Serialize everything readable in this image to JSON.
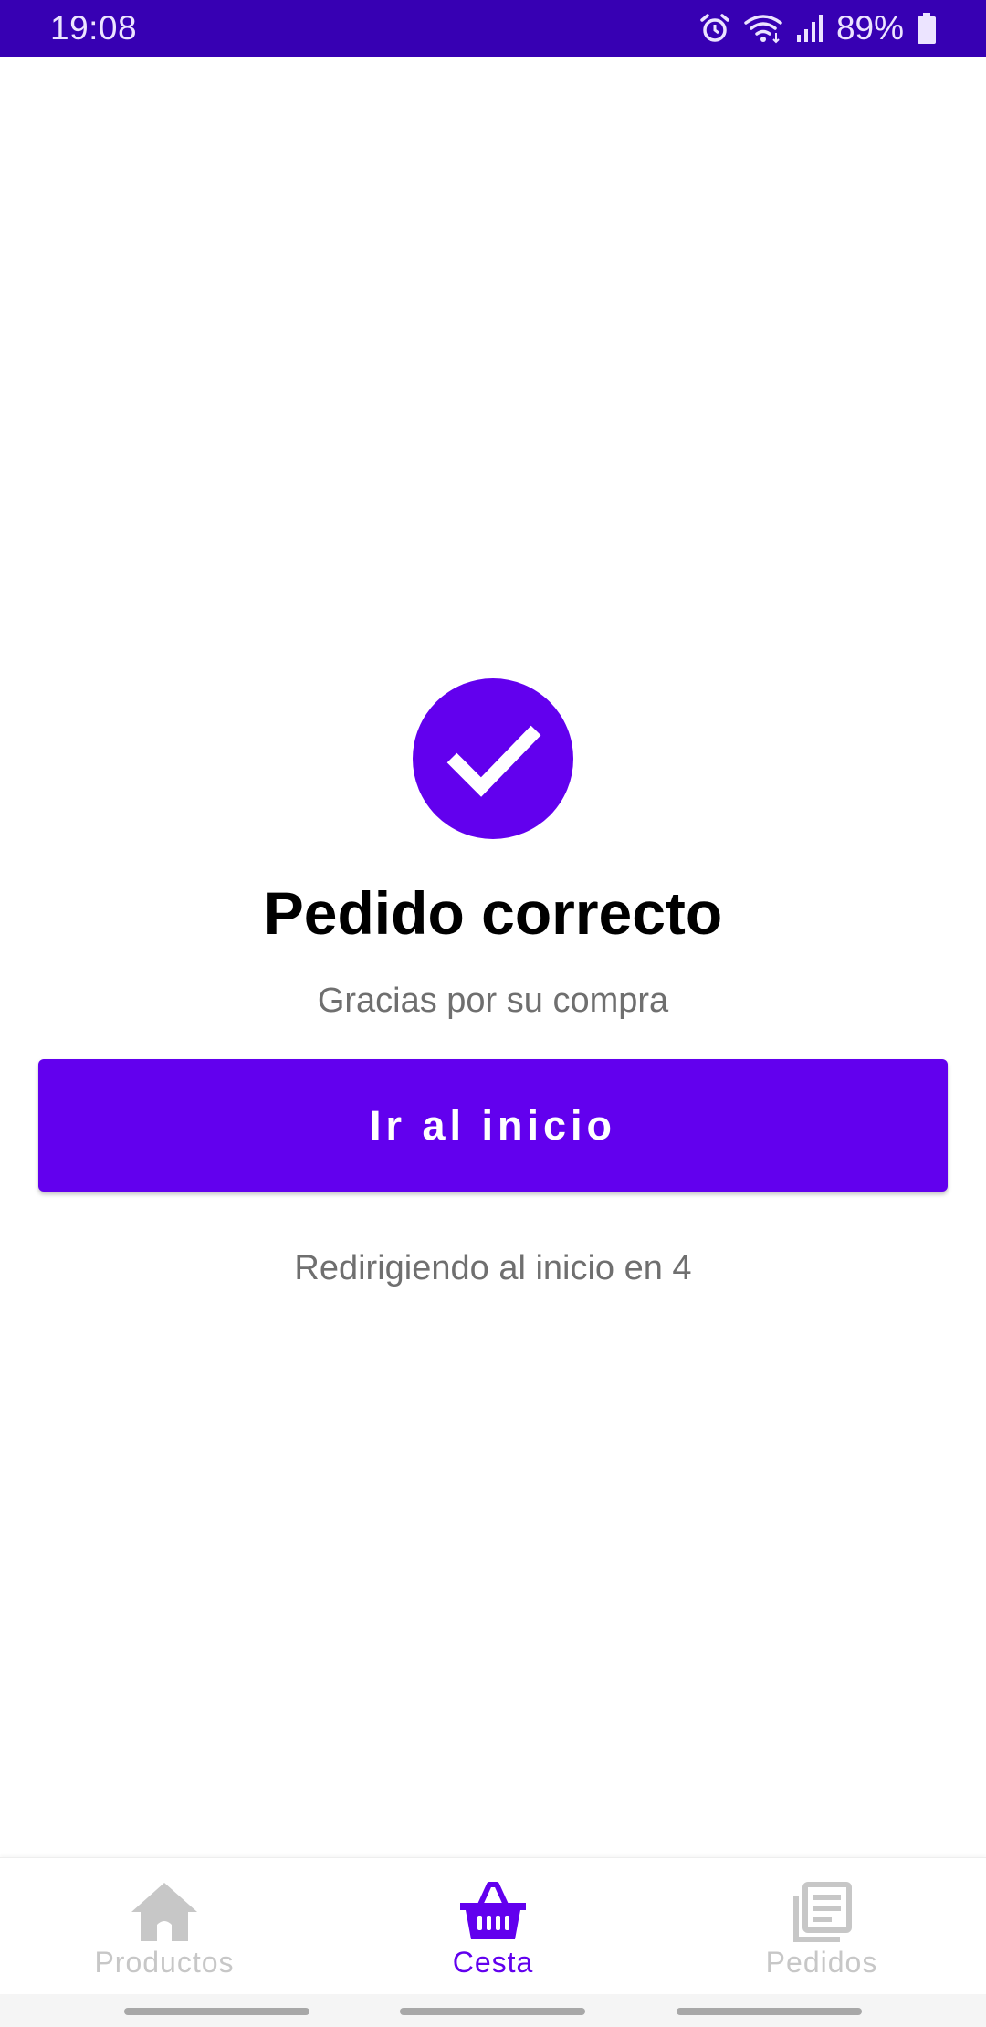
{
  "status_bar": {
    "time": "19:08",
    "battery": "89%",
    "icons": [
      "alarm-icon",
      "wifi-icon",
      "signal-icon",
      "battery-icon"
    ]
  },
  "success": {
    "icon": "check-icon",
    "title": "Pedido correcto",
    "subtitle": "Gracias por su compra",
    "button_label": "Ir al inicio",
    "redirect_text": "Redirigiendo al inicio en 4"
  },
  "bottom_nav": {
    "items": [
      {
        "label": "Productos",
        "icon": "home-icon",
        "active": false
      },
      {
        "label": "Cesta",
        "icon": "basket-icon",
        "active": true
      },
      {
        "label": "Pedidos",
        "icon": "orders-icon",
        "active": false
      }
    ]
  },
  "colors": {
    "primary": "#6200ee",
    "status_bar": "#3700b3",
    "inactive": "#c7c7c7",
    "secondary_text": "#6f6f6f"
  }
}
